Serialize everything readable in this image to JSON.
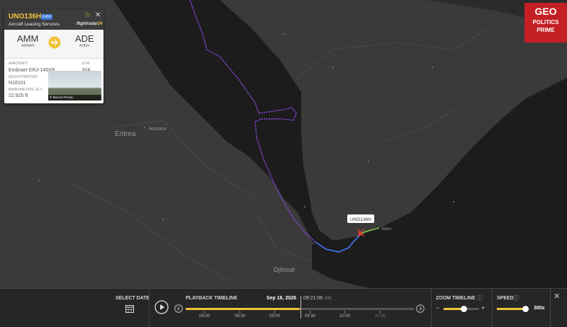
{
  "flight": {
    "callsign": "UNO136H",
    "type_badge": "E45X",
    "operator": "Aircraft Leasing Services",
    "logo": "flightradar",
    "logo_suffix": "24",
    "origin_code": "AMM",
    "origin_city": "AMMAN",
    "dest_code": "ADE",
    "dest_city": "ADEN",
    "aircraft_label": "AIRCRAFT",
    "aircraft_value": "Embraer ERJ-145XR",
    "eta_label": "ETA",
    "eta_value": "N/A",
    "registration_label": "REGISTRATION",
    "registration_value": "N18101",
    "altitude_label": "BAROMETRIC ALT.",
    "altitude_value": "22,925 ft",
    "photo_credit": "© Marvin Pirmau"
  },
  "map": {
    "aircraft_tag": "UNO136H",
    "labels": {
      "eritrea": "Eritrea",
      "asmara": "Asmara",
      "djibouti": "Djibouti",
      "aden": "Aden"
    },
    "colors": {
      "land": "#3a3a3a",
      "sea": "#1c1c1c",
      "track": "#9b4dff",
      "track_end": "#3f78ff"
    }
  },
  "brand": {
    "line1": "GEO",
    "line2": "POLITICS",
    "line3": "PRIME"
  },
  "playback": {
    "select_date_label": "SELECT DATE",
    "timeline_label": "PLAYBACK TIMELINE",
    "date": "Sep 16, 2026",
    "time": "09:21:06",
    "timezone": "UTC",
    "ticks": [
      "08:00",
      "08:30",
      "09:00",
      "09:30",
      "10:00",
      "10:30"
    ],
    "zoom_label": "ZOOM TIMELINE",
    "speed_label": "SPEED",
    "speed_value": "300x",
    "progress": 0.5
  }
}
